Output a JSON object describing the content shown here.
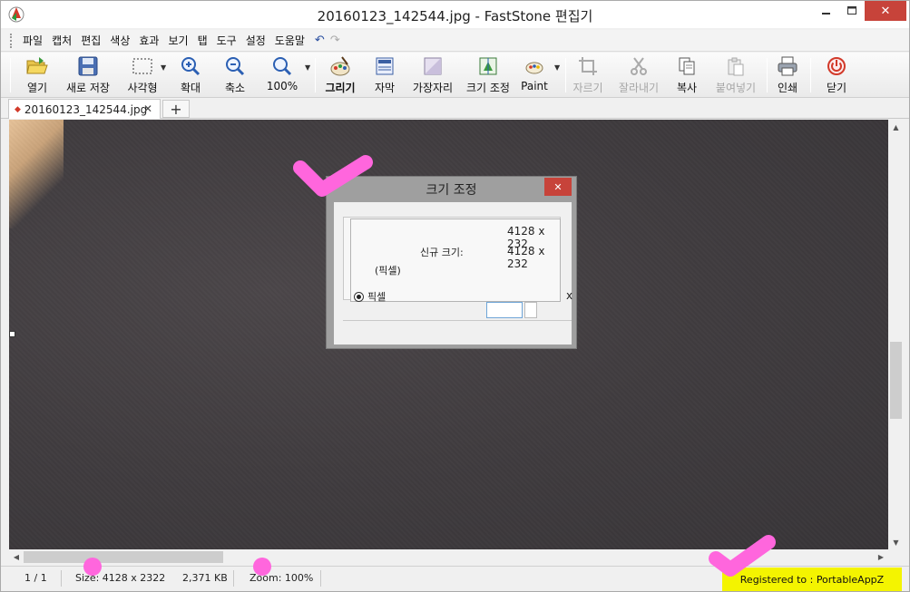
{
  "window": {
    "title": "20160123_142544.jpg - FastStone 편집기",
    "min_icon": "minimize-icon",
    "max_icon": "maximize-icon",
    "close_label": "✕"
  },
  "menu": {
    "items": [
      "파일",
      "캡처",
      "편집",
      "색상",
      "효과",
      "보기",
      "탭",
      "도구",
      "설정",
      "도움말"
    ],
    "undo_glyph": "↶",
    "redo_glyph": "↷"
  },
  "toolbar": {
    "open": "열기",
    "save_new": "새로 저장",
    "rect": "사각형",
    "zoom_in": "확대",
    "zoom_out": "축소",
    "zoom_pct": "100%",
    "draw": "그리기",
    "caption": "자막",
    "edge": "가장자리",
    "resize": "크기 조정",
    "paint": "Paint",
    "crop": "자르기",
    "cut": "잘라내기",
    "copy": "복사",
    "paste": "붙여넣기",
    "print": "인쇄",
    "close": "닫기"
  },
  "tabs": {
    "doc_name": "20160123_142544.jpg",
    "close_glyph": "✕",
    "new_tab_glyph": "+"
  },
  "dialog": {
    "title": "크기 조정",
    "close_glyph": "✕",
    "original_size": "4128 x 232",
    "new_size_label": "신규 크기:",
    "new_size_value": "4128 x 232",
    "unit_label": "(픽셀)",
    "radio_pixel": "픽셀",
    "x_label": "x"
  },
  "status": {
    "page": "1 / 1",
    "size": "Size: 4128 x 2322",
    "filesize": "2,371 KB",
    "zoom": "Zoom: 100%",
    "registered": "Registered to : PortableAppZ"
  },
  "colors": {
    "accent_close": "#c7433a",
    "registered_bg": "#f4f400",
    "annotation": "#ff66dd"
  }
}
